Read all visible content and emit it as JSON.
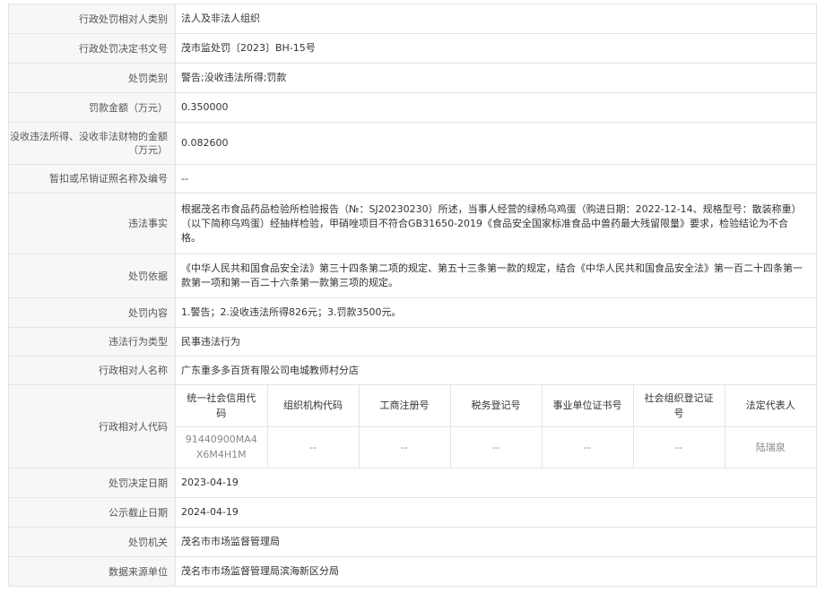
{
  "rows": {
    "party_category": {
      "label": "行政处罚相对人类别",
      "value": "法人及非法人组织"
    },
    "decision_number": {
      "label": "行政处罚决定书文号",
      "value": "茂市监处罚〔2023〕BH-15号"
    },
    "penalty_type": {
      "label": "处罚类别",
      "value": "警告;没收违法所得;罚款"
    },
    "fine_amount": {
      "label": "罚款金额（万元）",
      "value": "0.350000"
    },
    "confiscation_amount": {
      "label": "没收违法所得、没收非法财物的金额（万元）",
      "value": "0.082600"
    },
    "license_info": {
      "label": "暂扣或吊销证照名称及编号",
      "value": "--"
    },
    "violation_facts": {
      "label": "违法事实",
      "value": "根据茂名市食品药品检验所检验报告（№：SJ20230230）所述，当事人经营的绿杨乌鸡蛋（购进日期：2022-12-14、规格型号：散装称重）（以下简称乌鸡蛋）经抽样检验，甲硝唑项目不符合GB31650-2019《食品安全国家标准食品中兽药最大残留限量》要求，检验结论为不合格。"
    },
    "penalty_basis": {
      "label": "处罚依据",
      "value": "《中华人民共和国食品安全法》第三十四条第二项的规定、第五十三条第一款的规定，结合《中华人民共和国食品安全法》第一百二十四条第一款第一项和第一百二十六条第一款第三项的规定。"
    },
    "penalty_content": {
      "label": "处罚内容",
      "value": "1.警告；2.没收违法所得826元；3.罚款3500元。"
    },
    "violation_type": {
      "label": "违法行为类型",
      "value": "民事违法行为"
    },
    "party_name": {
      "label": "行政相对人名称",
      "value": "广东重多多百货有限公司电城教师村分店"
    },
    "party_code": {
      "label": "行政相对人代码",
      "headers": [
        "统一社会信用代码",
        "组织机构代码",
        "工商注册号",
        "税务登记号",
        "事业单位证书号",
        "社会组织登记证号",
        "法定代表人"
      ],
      "values": [
        "91440900MA4X6M4H1M",
        "--",
        "--",
        "--",
        "--",
        "--",
        "陆瑞泉"
      ]
    },
    "decision_date": {
      "label": "处罚决定日期",
      "value": "2023-04-19"
    },
    "publicity_deadline": {
      "label": "公示截止日期",
      "value": "2024-04-19"
    },
    "authority": {
      "label": "处罚机关",
      "value": "茂名市市场监督管理局"
    },
    "data_source": {
      "label": "数据来源单位",
      "value": "茂名市市场监督管理局滨海新区分局"
    }
  }
}
